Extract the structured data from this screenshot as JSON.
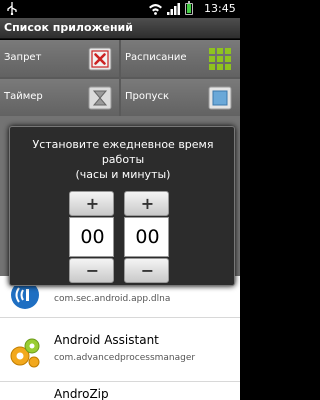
{
  "status_bar": {
    "time": "13:45",
    "icons": [
      "usb-icon",
      "wifi-icon",
      "signal-icon",
      "battery-icon"
    ]
  },
  "title_bar": {
    "title": "Список приложений"
  },
  "actions": [
    {
      "label": "Запрет",
      "icon": "block-icon"
    },
    {
      "label": "Расписание",
      "icon": "schedule-grid-icon"
    },
    {
      "label": "Таймер",
      "icon": "timer-icon"
    },
    {
      "label": "Пропуск",
      "icon": "skip-icon"
    }
  ],
  "dialog": {
    "message_line1": "Установите ежедневное время",
    "message_line2": "работы",
    "message_line3": "(часы и минуты)",
    "hours": {
      "plus": "+",
      "value": "00",
      "minus": "−"
    },
    "minutes": {
      "plus": "+",
      "value": "00",
      "minus": "−"
    }
  },
  "apps": [
    {
      "name": "",
      "package": "com.sec.android.app.dlna",
      "icon": "dlna-icon"
    },
    {
      "name": "Android Assistant",
      "package": "com.advancedprocessmanager",
      "icon": "gears-icon"
    },
    {
      "name": "AndroZip",
      "package": "",
      "icon": ""
    }
  ],
  "colors": {
    "status_bar": "#000000",
    "title_bar": "#3a3a3a",
    "action_cell": "#6e6e6e",
    "block_red": "#cc2222",
    "schedule_green": "#8fc31f",
    "skip_blue": "#6aa8d8"
  }
}
